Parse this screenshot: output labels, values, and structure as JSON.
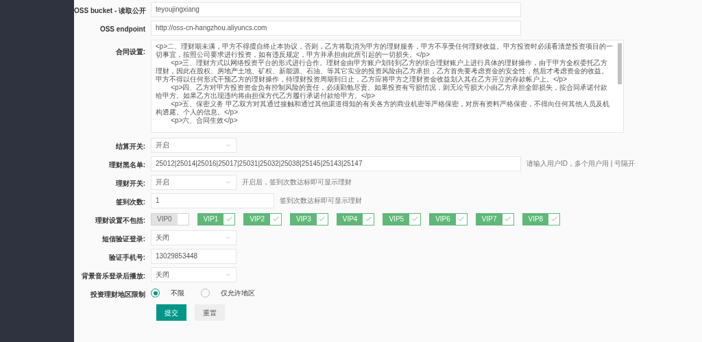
{
  "fields": [
    {
      "kind": "text",
      "label": "OSS bucket - 读取公开",
      "value": "teyoujingxiang"
    },
    {
      "kind": "text",
      "label": "OSS endpoint",
      "value": "http://oss-cn-hangzhou.aliyuncs.com"
    },
    {
      "kind": "textarea",
      "label": "合同设置:",
      "value": "<p>二、理财期未满，甲方不得擅自终止本协议，否则，乙方将取消为甲方的理财服务，甲方不享受任何理财收益。甲方投资时必须看清楚投资项目的一切事宜，按照公司要求进行投资，如有违反规定，甲方并承担由此所引起的一切损失。</p>\n        <p>三、理财方式以网络投资平台的形式进行合作。理财金由甲方账户划转到乙方的综合理财账户上进行具体的理财操作，由于甲方全权委托乙方理财，因此在股权、房地产土地、矿权、新能源、石油、等其它实业的投资风险由乙方承担，乙方首先要考虑资金的安全性，然后才考虑资金的收益。甲方不得以任何形式干预乙方的理财操作，待理财投资周期到日止，乙方应将甲方之理财资金收益划入其在乙方开立的存款帐户上。</p>\n        <p>四、乙方对甲方投资资金负有控制风险的责任，必须勤勉尽责。如果投资有亏损情况，则无论亏损大小由乙方承担全部损失，按合同承诺付款给甲方。如果乙方出现违约将由担保方代乙方履行承诺付款给甲方。</p>\n        <p>五、保密义务 甲乙双方对其通过接触和通过其他渠道得知的有关各方的商业机密等严格保密，对所有资料严格保密，不得向任何其他人员及机构透露。个人的信息。</p>\n        <p>六、合同生效</p>"
    },
    {
      "kind": "select",
      "label": "结算开关:",
      "value": "开启"
    },
    {
      "kind": "text",
      "label": "理财黑名单:",
      "value": "25012|25014|25016|25017|25031|25032|25038|25145|25143|25147",
      "hint": "请输入用户ID，多个用户用 | 号隔开"
    },
    {
      "kind": "select",
      "label": "理财开关:",
      "value": "开启",
      "hint": "开启后，签到次数达标即可显示理财"
    },
    {
      "kind": "text",
      "label": "签到次数:",
      "value": "1",
      "hint": "签到次数达标即可显示理财"
    },
    {
      "kind": "checkboxes",
      "label": "理财设置不包括:",
      "options": [
        {
          "label": "VIP0",
          "checked": false
        },
        {
          "label": "VIP1",
          "checked": true
        },
        {
          "label": "VIP2",
          "checked": true
        },
        {
          "label": "VIP3",
          "checked": true
        },
        {
          "label": "VIP4",
          "checked": true
        },
        {
          "label": "VIP5",
          "checked": true
        },
        {
          "label": "VIP6",
          "checked": true
        },
        {
          "label": "VIP7",
          "checked": true
        },
        {
          "label": "VIP8",
          "checked": true
        }
      ]
    },
    {
      "kind": "select",
      "label": "短信验证登录:",
      "value": "关闭"
    },
    {
      "kind": "text",
      "label": "验证手机号:",
      "value": "13029853448"
    },
    {
      "kind": "select",
      "label": "背景音乐登录后播放:",
      "value": "关闭"
    },
    {
      "kind": "radio",
      "label": "投资理财地区限制",
      "options": [
        {
          "label": "不限",
          "selected": true
        },
        {
          "label": "仅允许地区",
          "selected": false
        }
      ]
    }
  ],
  "buttons": [
    {
      "label": "提交",
      "kind": "primary"
    },
    {
      "label": "重置",
      "kind": "secondary"
    }
  ]
}
